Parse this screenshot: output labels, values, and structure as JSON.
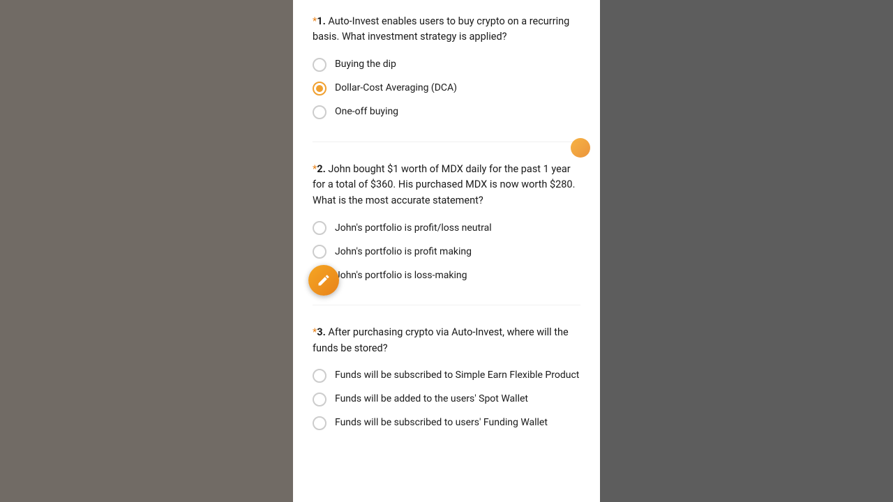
{
  "questions": [
    {
      "id": "q1",
      "number": "*1.",
      "text": "Auto-Invest enables users to buy crypto on a recurring basis. What investment strategy is applied?",
      "options": [
        {
          "id": "q1_a",
          "label": "Buying the dip",
          "selected": false
        },
        {
          "id": "q1_b",
          "label": "Dollar-Cost Averaging (DCA)",
          "selected": true
        },
        {
          "id": "q1_c",
          "label": "One-off buying",
          "selected": false
        }
      ]
    },
    {
      "id": "q2",
      "number": "*2.",
      "text": "John bought $1 worth of MDX daily for the past 1 year for a total of $360. His purchased MDX is now worth $280. What is the most accurate statement?",
      "options": [
        {
          "id": "q2_a",
          "label": "John's portfolio is profit/loss neutral",
          "selected": false
        },
        {
          "id": "q2_b",
          "label": "John's portfolio is profit making",
          "selected": false
        },
        {
          "id": "q2_c",
          "label": "John's portfolio is loss-making",
          "selected": false
        }
      ]
    },
    {
      "id": "q3",
      "number": "*3.",
      "text": "After purchasing crypto via Auto-Invest, where will the funds be stored?",
      "options": [
        {
          "id": "q3_a",
          "label": "Funds will be subscribed to Simple Earn Flexible Product",
          "selected": false
        },
        {
          "id": "q3_b",
          "label": "Funds will be added to the users' Spot Wallet",
          "selected": false
        },
        {
          "id": "q3_c",
          "label": "Funds will be subscribed to users' Funding Wallet",
          "selected": false
        }
      ]
    }
  ],
  "floatingBtn": {
    "icon": "pencil"
  }
}
